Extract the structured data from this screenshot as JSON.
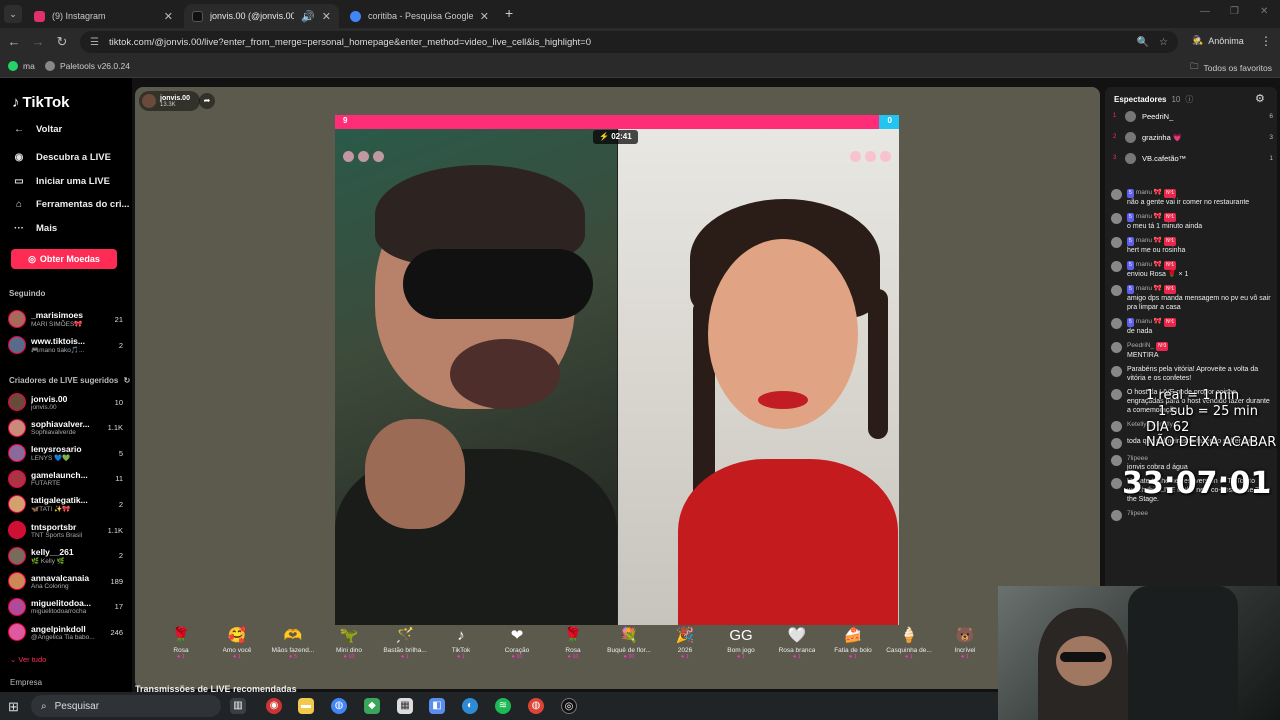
{
  "browser": {
    "tabs": [
      {
        "title": "(9) Instagram",
        "color": "#e1306c"
      },
      {
        "title": "jonvis.00 (@jonvis.00) com",
        "color": "#111111"
      },
      {
        "title": "coritiba - Pesquisa Google",
        "color": "#4285f4"
      }
    ],
    "url": "tiktok.com/@jonvis.00/live?enter_from_merge=personal_homepage&enter_method=video_live_cell&is_highlight=0",
    "incognito_label": "Anônima",
    "bookmarks": [
      "ma",
      "Paletools v26.0.24"
    ],
    "all_bookmarks": "Todos os favoritos"
  },
  "sidebar": {
    "logo": "TikTok",
    "back": "Voltar",
    "nav": [
      {
        "label": "Descubra a LIVE",
        "icon": "live-icon"
      },
      {
        "label": "Iniciar uma LIVE",
        "icon": "camera-icon"
      },
      {
        "label": "Ferramentas do cri...",
        "icon": "home-icon"
      },
      {
        "label": "Mais",
        "icon": "more-icon"
      }
    ],
    "coins_button": "Obter Moedas",
    "following_title": "Seguindo",
    "following": [
      {
        "name": "_marisimoes",
        "sub": "MARI SIMÕES🎀",
        "count": "21"
      },
      {
        "name": "www.tiktois...",
        "sub": "🎮mano tiako🎵...",
        "count": "2"
      }
    ],
    "suggested_title": "Criadores de LIVE sugeridos",
    "suggested": [
      {
        "name": "jonvis.00",
        "sub": "jonvis.00",
        "count": "10"
      },
      {
        "name": "sophiavalver...",
        "sub": "Sophiavalverde",
        "count": "1.1K"
      },
      {
        "name": "lenysrosario",
        "sub": "LENYS 💙💚",
        "count": "5"
      },
      {
        "name": "gamelaunch...",
        "sub": "FUTARTE",
        "count": "11"
      },
      {
        "name": "tatigalegatik...",
        "sub": "🦋TATI ✨🎀",
        "count": "2"
      },
      {
        "name": "tntsportsbr",
        "sub": "TNT Sports Brasil",
        "count": "1.1K"
      },
      {
        "name": "kelly__261",
        "sub": "🌿 Kelly 🌿",
        "count": "2"
      },
      {
        "name": "annavalcanaia",
        "sub": "Ana Coloring",
        "count": "189"
      },
      {
        "name": "miguelitodoa...",
        "sub": "miguelitodoarrocha",
        "count": "17"
      },
      {
        "name": "angelpinkdoll",
        "sub": "@Angelica Tia babo...",
        "count": "246"
      }
    ],
    "see_all": "Ver tudo",
    "company": "Empresa"
  },
  "stream": {
    "host_name": "jonvis.00",
    "host_viewers": "13.3K",
    "score_left": "9",
    "score_right": "0",
    "timer": "02:41",
    "gifts": [
      {
        "name": "Rosa",
        "price": "1",
        "icon": "🌹"
      },
      {
        "name": "Amo você",
        "price": "1",
        "icon": "🥰"
      },
      {
        "name": "Mãos fazend...",
        "price": "5",
        "icon": "🫶"
      },
      {
        "name": "Mini dino",
        "price": "10",
        "icon": "🦖"
      },
      {
        "name": "Bastão brilha...",
        "price": "1",
        "icon": "🪄"
      },
      {
        "name": "TikTok",
        "price": "1",
        "icon": "♪"
      },
      {
        "name": "Coração",
        "price": "10",
        "icon": "❤"
      },
      {
        "name": "Rosa",
        "price": "10",
        "icon": "🌹"
      },
      {
        "name": "Buquê de flor...",
        "price": "30",
        "icon": "💐"
      },
      {
        "name": "2026",
        "price": "1",
        "icon": "🎉"
      },
      {
        "name": "Bom jogo",
        "price": "1",
        "icon": "GG"
      },
      {
        "name": "Rosa branca",
        "price": "1",
        "icon": "🤍"
      },
      {
        "name": "Fatia de bolo",
        "price": "1",
        "icon": "🍰"
      },
      {
        "name": "Casquinha de...",
        "price": "1",
        "icon": "🍦"
      },
      {
        "name": "Incrível",
        "price": "1",
        "icon": "🐻"
      }
    ],
    "recommended": "Transmissões de LIVE recomendadas"
  },
  "chat": {
    "viewers_title": "Espectadores",
    "viewers_count": "10",
    "top_viewers": [
      {
        "rank": "1",
        "name": "PeedriN_",
        "score": "6"
      },
      {
        "rank": "2",
        "name": "grazinha 💗",
        "score": "3"
      },
      {
        "rank": "3",
        "name": "VB.cafetão™",
        "score": "1"
      }
    ],
    "messages": [
      {
        "user": "manu 🎀",
        "level": "5",
        "fan": "Nº1",
        "text": "não a gente vai ir comer no restaurante"
      },
      {
        "user": "manu 🎀",
        "level": "5",
        "fan": "Nº1",
        "text": "o meu tá 1 minuto ainda"
      },
      {
        "user": "manu 🎀",
        "level": "5",
        "fan": "Nº1",
        "text": "hert me ou rosinha"
      },
      {
        "user": "manu 🎀",
        "level": "5",
        "fan": "Nº1",
        "text": "enviou Rosa 🌹 × 1"
      },
      {
        "user": "manu 🎀",
        "level": "5",
        "fan": "Nº1",
        "text": "amigo dps manda mensagem no pv eu vô sair pra limpar a casa"
      },
      {
        "user": "manu 🎀",
        "level": "5",
        "fan": "Nº1",
        "text": "de nada"
      },
      {
        "user": "PeedriN_",
        "level": "",
        "fan": "Nº3",
        "text": "MENTIRA"
      },
      {
        "user": "",
        "level": "",
        "fan": "",
        "text": "Parabéns pela vitória! Aproveite a volta da vitória e os confetes!"
      },
      {
        "user": "",
        "level": "",
        "fan": "",
        "text": "O host da LIVE pode propor coisas engraçadas para o host vencido fazer durante a comemoração."
      },
      {
        "user": "Ketellyn Kemilly",
        "level": "",
        "fan": "",
        "text": ""
      },
      {
        "user": "",
        "level": "",
        "fan": "",
        "text": "toda que palmeiras tá fazendo sofrer tbm"
      },
      {
        "user": "7lipeee",
        "level": "",
        "fan": "",
        "text": "jonvis cobra d água"
      },
      {
        "user": "",
        "level": "",
        "fan": "",
        "text": "Update to the newest version of TikTok to watch this LIVE in the new co-host mode Take the Stage."
      },
      {
        "user": "7lipeee",
        "level": "",
        "fan": "",
        "text": ""
      }
    ]
  },
  "overlay": {
    "line1": "1 real = 1 min",
    "line2": "1 sub = 25 min",
    "line3": "DIA 62",
    "line4": "NÃO DEIXA ACABAR",
    "countdown": "33:07:01"
  },
  "taskbar": {
    "search_placeholder": "Pesquisar"
  }
}
